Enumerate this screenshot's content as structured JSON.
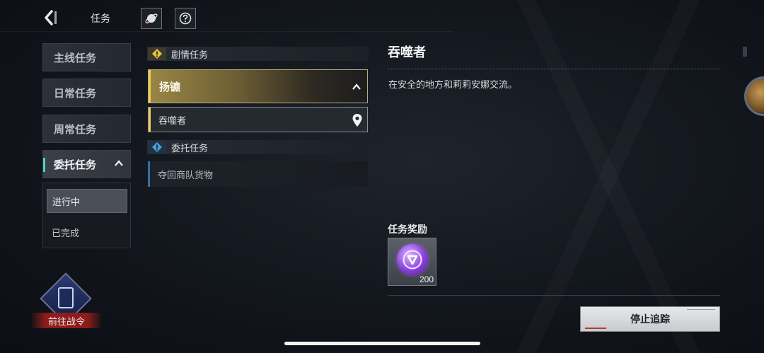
{
  "header": {
    "title": "任务",
    "icons": [
      "back-chevron-icon",
      "planet-icon",
      "help-icon"
    ]
  },
  "categories": [
    {
      "label": "主线任务",
      "active": false
    },
    {
      "label": "日常任务",
      "active": false
    },
    {
      "label": "周常任务",
      "active": false
    },
    {
      "label": "委托任务",
      "active": true
    }
  ],
  "sub_filters": [
    {
      "label": "进行中",
      "active": true
    },
    {
      "label": "已完成",
      "active": false
    }
  ],
  "battle_pass": {
    "label": "前往战令"
  },
  "quest_groups": {
    "story": {
      "label": "剧情任务",
      "icon_color": "#e8c33a"
    },
    "commission": {
      "label": "委托任务",
      "icon_color": "#4a9fd8"
    }
  },
  "quests": {
    "selected_chapter": "扬镳",
    "selected_quest": "吞噬者",
    "commission_item": "夺回商队货物"
  },
  "detail": {
    "title": "吞噬者",
    "description": "在安全的地方和莉莉安娜交流。",
    "reward_title": "任务奖励",
    "reward_qty": "200",
    "stop_button": "停止追踪"
  },
  "colors": {
    "accent_gold": "#f0cb57",
    "accent_teal": "#4fd1c5",
    "battle_pass_red": "#8d1c1c"
  }
}
